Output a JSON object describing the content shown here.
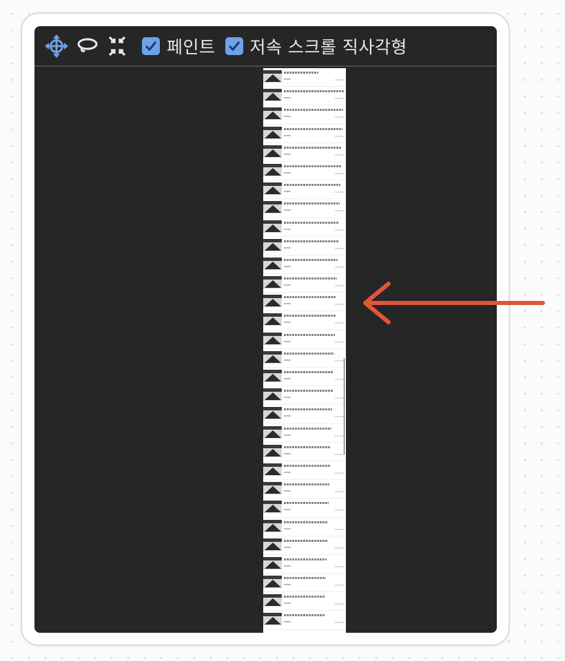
{
  "toolbar": {
    "tools": [
      {
        "icon": "move-icon"
      },
      {
        "icon": "lasso-icon"
      },
      {
        "icon": "collapse-icon"
      }
    ],
    "checkboxes": [
      {
        "label": "페인트",
        "checked": true
      },
      {
        "label": "저속 스크롤 직사각형",
        "checked": true
      }
    ]
  },
  "colors": {
    "panel": "#262626",
    "accent_blue": "#6ea1e8",
    "arrow": "#e2553a"
  },
  "annotation": {
    "icon": "arrow-left-icon"
  }
}
